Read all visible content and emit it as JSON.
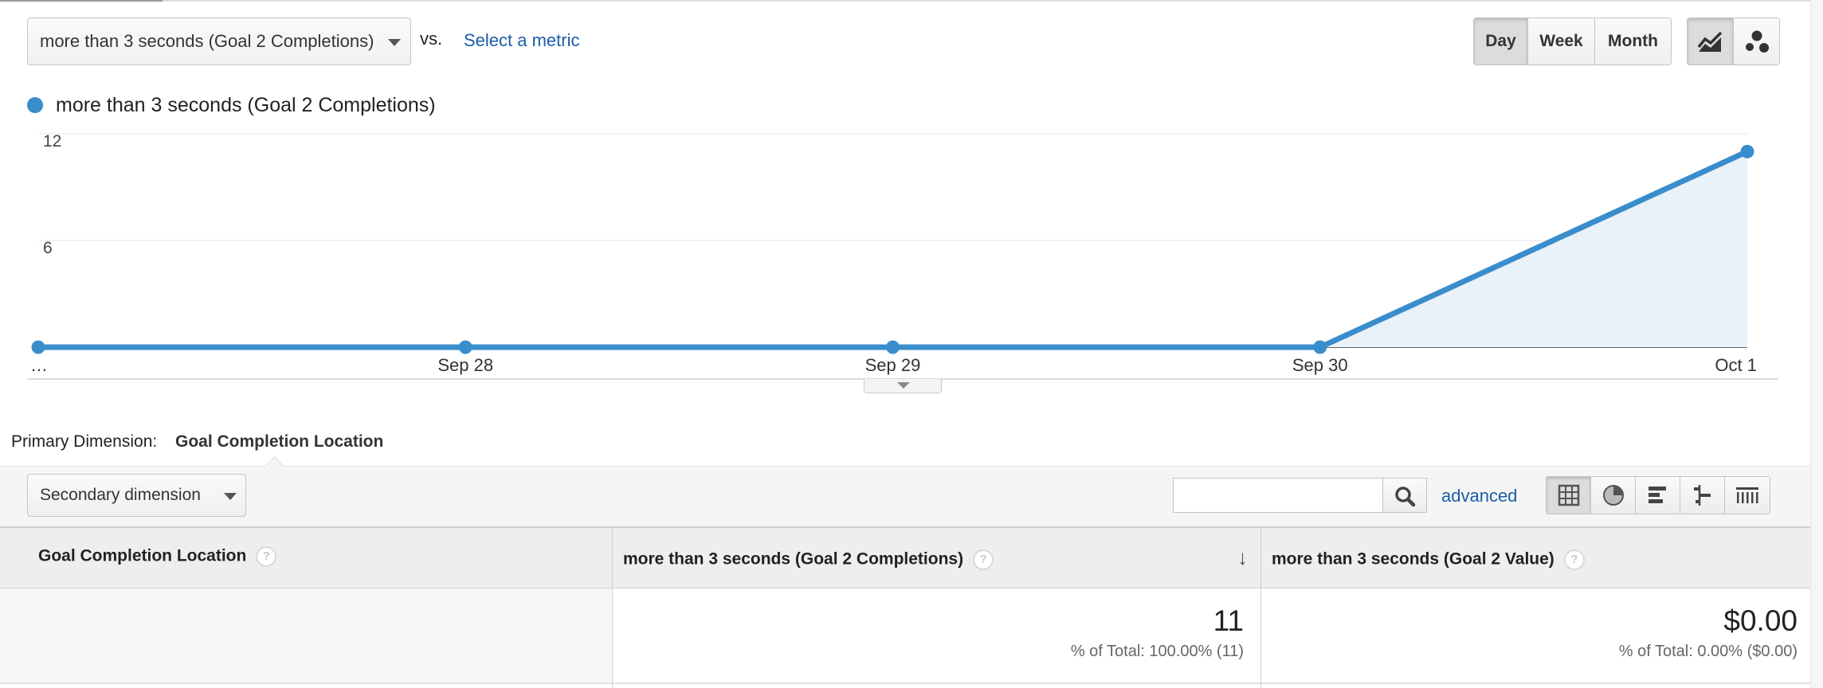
{
  "controls": {
    "metric_select": "more than 3 seconds (Goal 2 Completions)",
    "vs_text": "vs.",
    "select_metric_link": "Select a metric",
    "interval_buttons": [
      {
        "label": "Day",
        "active": true
      },
      {
        "label": "Week",
        "active": false
      },
      {
        "label": "Month",
        "active": false
      }
    ],
    "chart_type_buttons": [
      {
        "icon": "line-chart-icon",
        "active": true
      },
      {
        "icon": "motion-chart-icon",
        "active": false
      }
    ]
  },
  "legend": {
    "label": "more than 3 seconds (Goal 2 Completions)",
    "color": "#3a8dcb"
  },
  "chart_data": {
    "type": "area",
    "categories": [
      "…",
      "Sep 28",
      "Sep 29",
      "Sep 30",
      "Oct 1"
    ],
    "series": [
      {
        "name": "more than 3 seconds (Goal 2 Completions)",
        "values": [
          0,
          0,
          0,
          0,
          11
        ],
        "color": "#3a8dcb"
      }
    ],
    "yticks": [
      6,
      12
    ],
    "ylim": [
      0,
      12
    ],
    "grid": true
  },
  "primary_dimension": {
    "label": "Primary Dimension:",
    "value": "Goal Completion Location"
  },
  "toolbar": {
    "secondary_dimension": "Secondary dimension",
    "search_placeholder": "",
    "advanced_link": "advanced",
    "view_icons": [
      "table-view-icon",
      "pie-view-icon",
      "performance-view-icon",
      "comparison-view-icon",
      "pivot-view-icon"
    ]
  },
  "table": {
    "columns": [
      {
        "label": "Goal Completion Location",
        "help": "?"
      },
      {
        "label": "more than 3 seconds (Goal 2 Completions)",
        "help": "?",
        "sort": "↓"
      },
      {
        "label": "more than 3 seconds (Goal 2 Value)",
        "help": "?"
      }
    ],
    "totals": {
      "completions": "11",
      "completions_pct": "% of Total: 100.00% (11)",
      "value": "$0.00",
      "value_pct": "% of Total: 0.00% ($0.00)"
    }
  }
}
